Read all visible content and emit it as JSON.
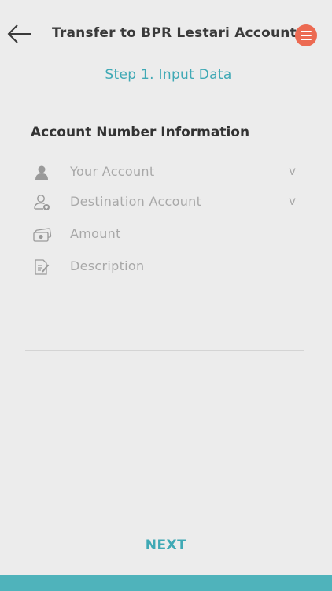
{
  "header": {
    "title": "Transfer to BPR Lestari Account",
    "back_icon": "arrow-left-icon",
    "menu_icon": "hamburger-menu-icon"
  },
  "step": {
    "label": "Step 1. Input Data"
  },
  "form": {
    "section_title": "Account Number Information",
    "fields": [
      {
        "label": "Your Account",
        "icon": "user-icon",
        "chevron": "v"
      },
      {
        "label": "Destination Account",
        "icon": "user-add-icon",
        "chevron": "v"
      },
      {
        "label": "Amount",
        "icon": "money-icon"
      },
      {
        "label": "Description",
        "icon": "edit-document-icon"
      }
    ]
  },
  "footer": {
    "next_label": "NEXT"
  },
  "colors": {
    "accent": "#3fa9b5",
    "menu_button": "#ec6a52",
    "bottom_bar": "#4fb3bb",
    "background": "#ececec"
  }
}
